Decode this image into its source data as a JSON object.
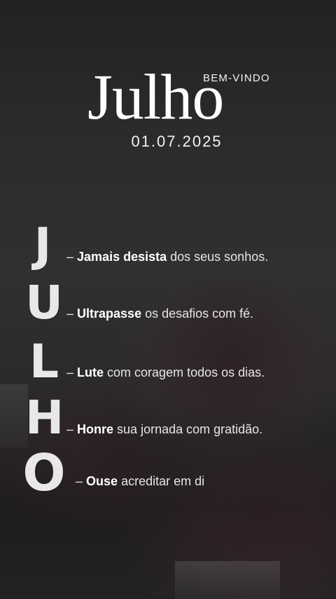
{
  "header": {
    "welcome": "BEM-VINDO",
    "month": "Julho",
    "date": "01.07.2025"
  },
  "acrostic": [
    {
      "letter": "J",
      "dash": "–",
      "bold": "Jamais desista",
      "rest": " dos seus sonhos."
    },
    {
      "letter": "U",
      "dash": "–",
      "bold": "Ultrapasse",
      "rest": " os desafios com fé."
    },
    {
      "letter": "L",
      "dash": "–",
      "bold": "Lute",
      "rest": " com coragem todos os dias."
    },
    {
      "letter": "H",
      "dash": "–",
      "bold": "Honre",
      "rest": " sua jornada com gratidão."
    },
    {
      "letter": "O",
      "dash": "–",
      "bold": "Ouse",
      "rest": " acreditar em di"
    }
  ]
}
